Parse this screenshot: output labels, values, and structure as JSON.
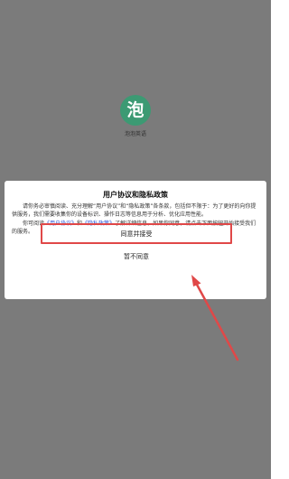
{
  "app": {
    "icon_glyph": "泡",
    "name": "泡泡英语",
    "icon_color": "#3c9a73"
  },
  "dialog": {
    "title": "用户协议和隐私政策",
    "para1": "请你务必审慎阅读、充分理解“用户协议”和“隐私政策”各条款，包括但不限于：为了更好的向你提供服务，我们需要收集你的设备标识、操作日志等信息用于分析、优化应用性能。",
    "para2_prefix": "你可阅读",
    "link_user_agreement": "《用户协议》",
    "para2_and": "和",
    "link_privacy_policy": "《隐私政策》",
    "para2_suffix": "了解详细信息。如果你同意，请点击下面按钮开始接受我们的服务。",
    "agree_label": "同意并接受",
    "disagree_label": "暂不同意"
  },
  "colors": {
    "overlay": "#7b7b7b",
    "highlight": "#e04848",
    "link": "#2f56d8"
  }
}
